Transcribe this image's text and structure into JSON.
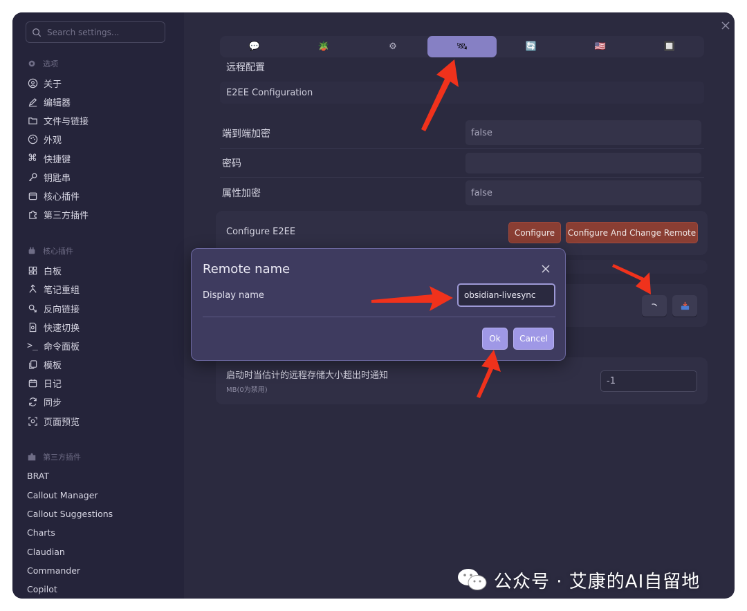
{
  "sidebar": {
    "search_placeholder": "Search settings...",
    "options_header": "选项",
    "options": [
      {
        "label": "关于",
        "icon": "info-circle-icon"
      },
      {
        "label": "编辑器",
        "icon": "pencil-icon"
      },
      {
        "label": "文件与链接",
        "icon": "folder-link-icon"
      },
      {
        "label": "外观",
        "icon": "palette-icon"
      },
      {
        "label": "快捷键",
        "icon": "command-icon"
      },
      {
        "label": "钥匙串",
        "icon": "key-icon"
      },
      {
        "label": "核心插件",
        "icon": "calendar-icon"
      },
      {
        "label": "第三方插件",
        "icon": "puzzle-icon"
      }
    ],
    "core_header": "核心插件",
    "core": [
      {
        "label": "白板",
        "icon": "canvas-icon"
      },
      {
        "label": "笔记重组",
        "icon": "merge-icon"
      },
      {
        "label": "反向链接",
        "icon": "backlink-icon"
      },
      {
        "label": "快速切换",
        "icon": "file-search-icon"
      },
      {
        "label": "命令面板",
        "icon": "terminal-icon"
      },
      {
        "label": "模板",
        "icon": "copy-icon"
      },
      {
        "label": "日记",
        "icon": "calendar-icon"
      },
      {
        "label": "同步",
        "icon": "refresh-icon"
      },
      {
        "label": "页面预览",
        "icon": "preview-icon"
      }
    ],
    "third_header": "第三方插件",
    "third": [
      "BRAT",
      "Callout Manager",
      "Callout Suggestions",
      "Charts",
      "Claudian",
      "Commander",
      "Copilot"
    ]
  },
  "tabs": [
    {
      "icon": "chat-bubble-icon",
      "glyph": "💬",
      "active": false
    },
    {
      "icon": "potted-plant-icon",
      "glyph": "🪴",
      "active": false
    },
    {
      "icon": "gear-icon",
      "glyph": "⚙",
      "active": false
    },
    {
      "icon": "satellite-icon",
      "glyph": "🛰",
      "active": true
    },
    {
      "icon": "sync-icon",
      "glyph": "🔄",
      "active": false
    },
    {
      "icon": "flag-icon",
      "glyph": "🇺🇸",
      "active": false
    },
    {
      "icon": "grid-icon",
      "glyph": "🔲",
      "active": false
    }
  ],
  "main": {
    "section_title": "远程配置",
    "e2ee_title": "E2EE Configuration",
    "rows": [
      {
        "label": "端到端加密",
        "value": "false"
      },
      {
        "label": "密码",
        "value": ""
      },
      {
        "label": "属性加密",
        "value": "false"
      }
    ],
    "configure_label": "Configure E2EE",
    "configure_btn": "Configure",
    "configure_change_btn": "Configure And Change Remote",
    "notify_label": "启动时当估计的远程存储大小超出时通知",
    "notify_sub": "MB(0为禁用)",
    "notify_value": "-1"
  },
  "modal": {
    "title": "Remote name",
    "field_label": "Display name",
    "field_value": "obsidian-livesync",
    "ok": "Ok",
    "cancel": "Cancel"
  },
  "watermark": "公众号 · 艾康的AI自留地"
}
